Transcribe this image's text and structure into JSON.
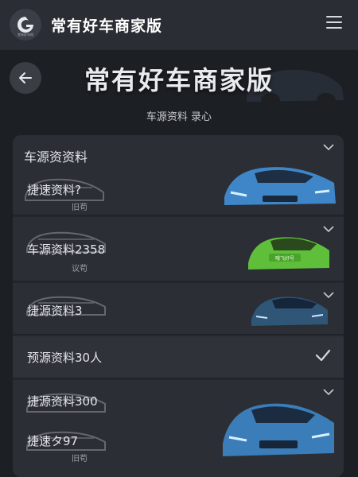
{
  "app": {
    "logo_text": "常有好车网",
    "title": "常有好车商家版"
  },
  "hero": {
    "title": "常有好车商家版",
    "subtitle": "车源资料 录心"
  },
  "cards": [
    {
      "title": "车源资资料",
      "label": "捷速资料?",
      "sub": "旧苟"
    },
    {
      "label": "车源资料2358",
      "sub": "议苟",
      "car_badge": "哦飞好号"
    },
    {
      "label": "捷源资料3"
    },
    {
      "label": "预源资料30人"
    },
    {
      "label": "捷源资料300",
      "label2": "捷速タ97",
      "sub": "旧苟"
    }
  ],
  "colors": {
    "accent_blue": "#3f86c8",
    "accent_green": "#5fbf3a",
    "background": "#1c1f24",
    "topbar": "#2a2d33"
  }
}
